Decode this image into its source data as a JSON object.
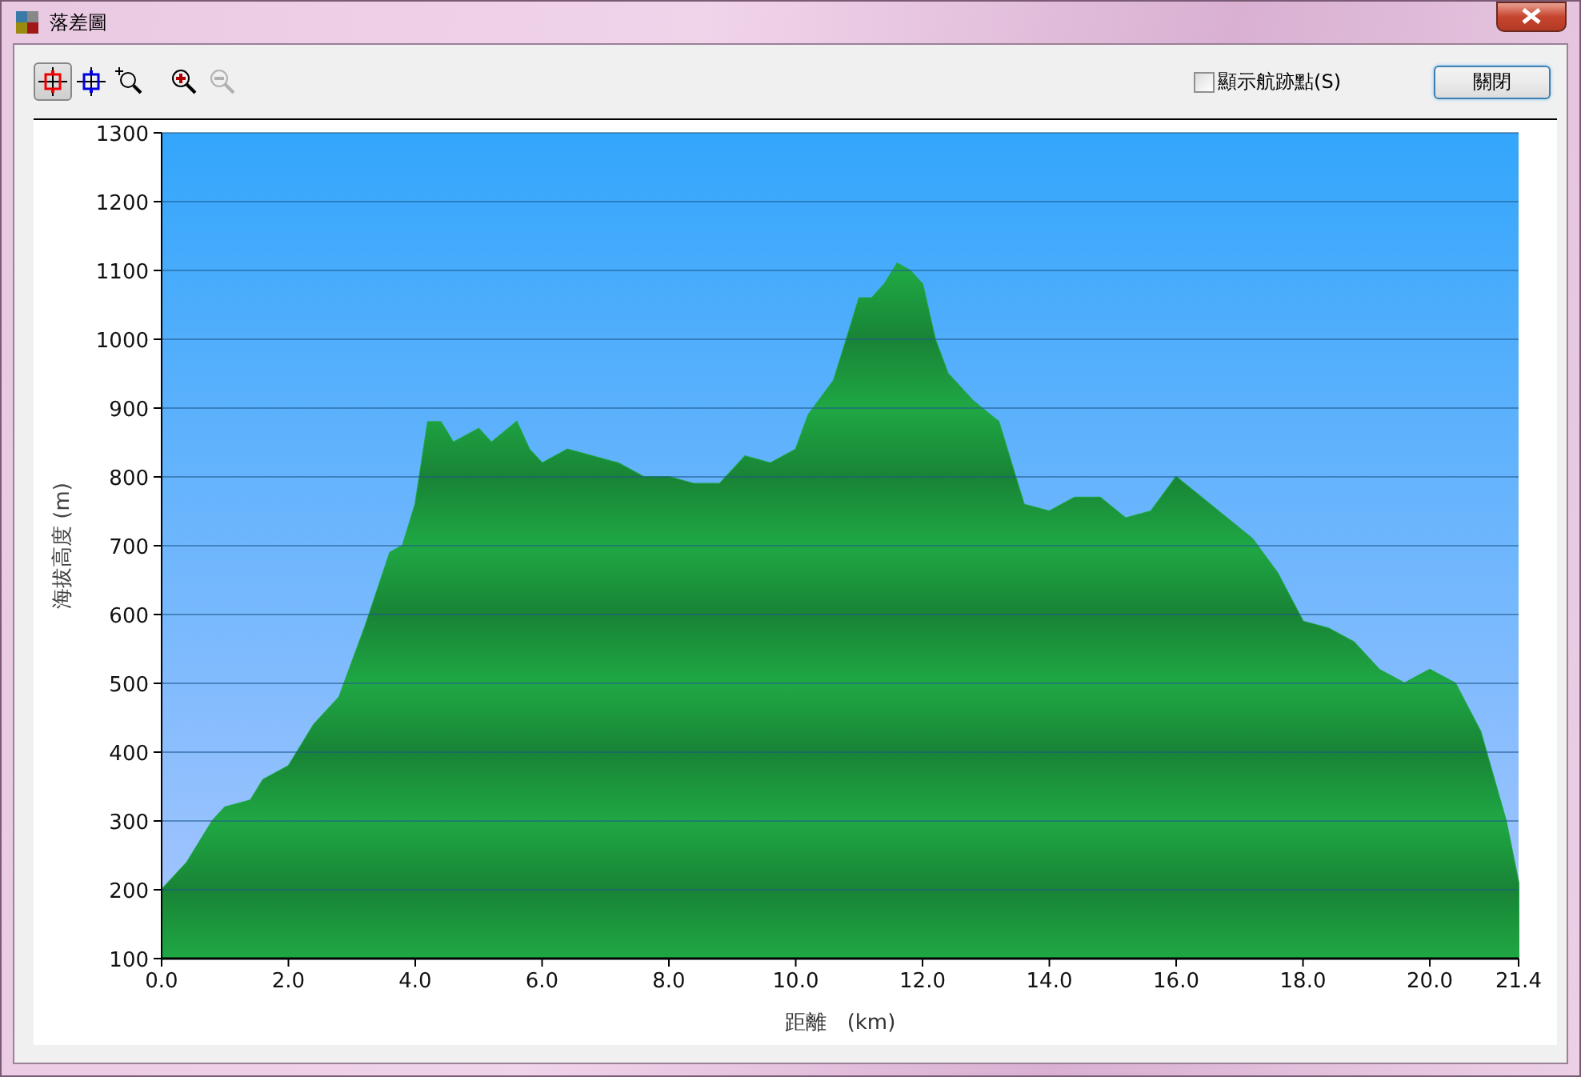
{
  "window": {
    "title": "落差圖"
  },
  "toolbar": {
    "tools": [
      {
        "kind": "marker-red",
        "selected": true,
        "disabled": false
      },
      {
        "kind": "marker-blue",
        "selected": false,
        "disabled": false
      },
      {
        "kind": "zoom-area",
        "selected": false,
        "disabled": false
      },
      {
        "kind": "zoom-in",
        "selected": false,
        "disabled": false
      },
      {
        "kind": "zoom-out",
        "selected": false,
        "disabled": true
      }
    ],
    "checkbox": {
      "label": "顯示航跡點(S)",
      "checked": false
    },
    "close_button": "關閉"
  },
  "chart": {
    "chart_data": {
      "type": "area",
      "xlabel": "距離　(km)",
      "ylabel": "海拔高度 (m)",
      "xlim": [
        0,
        21.4
      ],
      "ylim": [
        100,
        1300
      ],
      "x": [
        0,
        0.4,
        0.8,
        1.0,
        1.4,
        1.6,
        2.0,
        2.4,
        2.8,
        3.2,
        3.6,
        3.8,
        4.0,
        4.2,
        4.4,
        4.6,
        4.8,
        5.0,
        5.2,
        5.6,
        5.8,
        6.0,
        6.4,
        6.8,
        7.2,
        7.6,
        8.0,
        8.4,
        8.8,
        9.2,
        9.6,
        10.0,
        10.2,
        10.6,
        10.8,
        11.0,
        11.2,
        11.4,
        11.6,
        11.8,
        12.0,
        12.2,
        12.4,
        12.8,
        13.2,
        13.6,
        14.0,
        14.4,
        14.8,
        15.2,
        15.6,
        16.0,
        16.4,
        16.8,
        17.2,
        17.6,
        18.0,
        18.4,
        18.8,
        19.2,
        19.6,
        20.0,
        20.4,
        20.8,
        21.2,
        21.4
      ],
      "series": [
        {
          "color": "#1fa844",
          "values": [
            200,
            240,
            300,
            320,
            330,
            360,
            380,
            440,
            480,
            580,
            690,
            700,
            760,
            880,
            880,
            850,
            860,
            870,
            850,
            880,
            840,
            820,
            840,
            830,
            820,
            800,
            800,
            790,
            790,
            830,
            820,
            840,
            890,
            940,
            1000,
            1060,
            1060,
            1080,
            1110,
            1100,
            1080,
            1000,
            950,
            910,
            880,
            760,
            750,
            770,
            770,
            740,
            750,
            800,
            770,
            740,
            710,
            660,
            590,
            580,
            560,
            520,
            500,
            520,
            500,
            430,
            300,
            210
          ]
        }
      ],
      "xticks": [
        {
          "value": 0,
          "label": "0.0"
        },
        {
          "value": 2,
          "label": "2.0"
        },
        {
          "value": 4,
          "label": "4.0"
        },
        {
          "value": 6,
          "label": "6.0"
        },
        {
          "value": 8,
          "label": "8.0"
        },
        {
          "value": 10,
          "label": "10.0"
        },
        {
          "value": 12,
          "label": "12.0"
        },
        {
          "value": 14,
          "label": "14.0"
        },
        {
          "value": 16,
          "label": "16.0"
        },
        {
          "value": 18,
          "label": "18.0"
        },
        {
          "value": 20,
          "label": "20.0"
        },
        {
          "value": 21.4,
          "label": "21.4"
        }
      ],
      "grid": true,
      "yticks": [
        100,
        200,
        300,
        400,
        500,
        600,
        700,
        800,
        900,
        1000,
        1100,
        1200,
        1300
      ]
    }
  }
}
